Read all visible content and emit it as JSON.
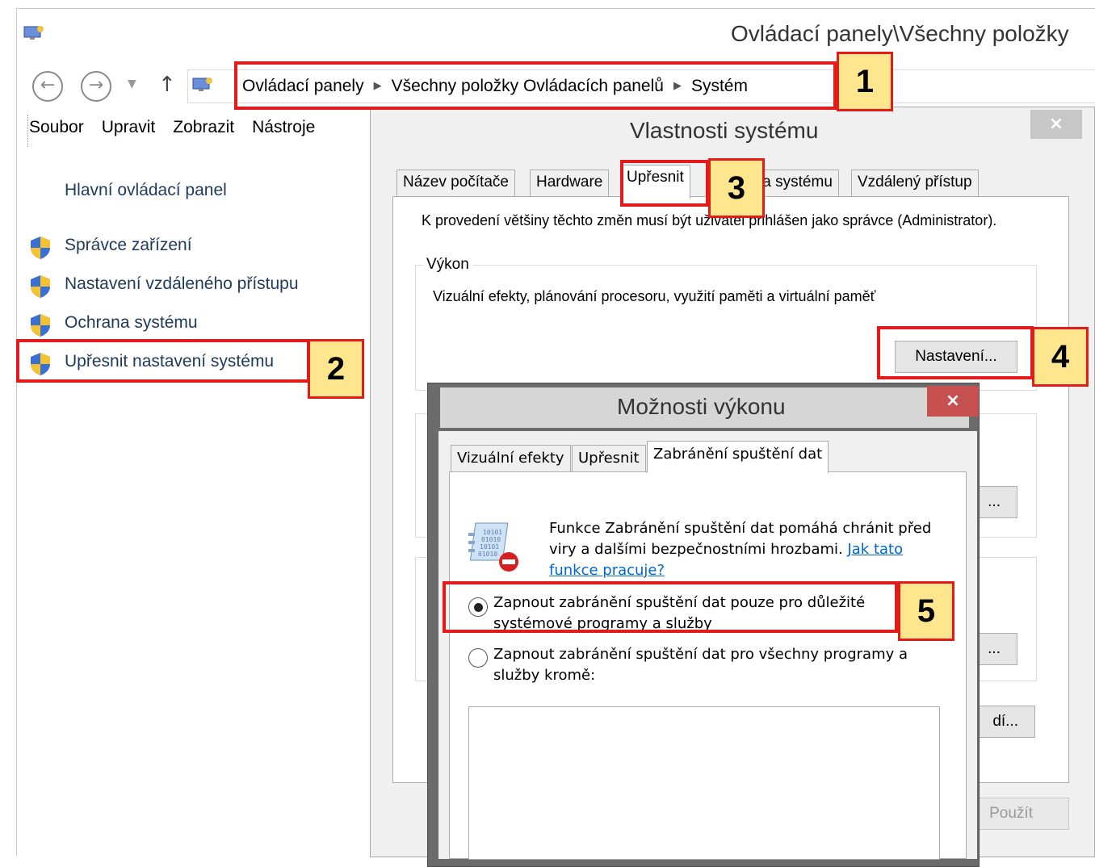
{
  "window": {
    "title": "Ovládací panely\\Všechny položky",
    "app_icon": "control-panel-icon"
  },
  "navigation": {
    "back_icon": "back-arrow-icon",
    "forward_icon": "forward-arrow-icon",
    "up_icon": "up-arrow-icon",
    "breadcrumb": [
      "Ovládací panely",
      "Všechny položky Ovládacích panelů",
      "Systém"
    ]
  },
  "menu": [
    "Soubor",
    "Upravit",
    "Zobrazit",
    "Nástroje"
  ],
  "left_nav": {
    "home": "Hlavní ovládací panel",
    "items": [
      {
        "label": "Správce zařízení",
        "icon": "shield-icon"
      },
      {
        "label": "Nastavení vzdáleného přístupu",
        "icon": "shield-icon"
      },
      {
        "label": "Ochrana systému",
        "icon": "shield-icon"
      },
      {
        "label": "Upřesnit nastavení systému",
        "icon": "shield-icon"
      }
    ]
  },
  "system_properties": {
    "title": "Vlastnosti systému",
    "close": "×",
    "tabs": [
      "Název počítače",
      "Hardware",
      "Upřesnit",
      "Ochrana systému",
      "Vzdálený přístup"
    ],
    "active_tab": "Upřesnit",
    "admin_note": "K provedení většiny těchto změn musí být uživatel přihlášen jako správce (Administrator).",
    "performance_group": "Výkon",
    "performance_desc": "Vizuální efekty, plánování procesoru, využití paměti a virtuální paměť",
    "settings_button": "Nastavení...",
    "hidden_btn_2": "...",
    "hidden_btn_3": "...",
    "hidden_btn_4": "dí...",
    "apply_button": "Použít"
  },
  "performance_options": {
    "title": "Možnosti výkonu",
    "close": "×",
    "tabs": [
      "Vizuální efekty",
      "Upřesnit",
      "Zabránění spuštění dat"
    ],
    "active_tab": "Zabránění spuštění dat",
    "icon": "data-execution-prevention-icon",
    "description": "Funkce Zabránění spuštění dat pomáhá chránit před viry a dalšími bezpečnostními hrozbami.",
    "link": "Jak tato funkce pracuje?",
    "option_essential": "Zapnout zabránění spuštění dat pouze pro důležité systémové programy a služby",
    "option_all": "Zapnout zabránění spuštění dat pro všechny programy a služby kromě:",
    "selected_option": "essential"
  },
  "annotations": {
    "colors": {
      "border": "#e41b1b",
      "badge_fill": "#fde68e"
    },
    "badges": [
      "1",
      "2",
      "3",
      "4",
      "5"
    ]
  }
}
